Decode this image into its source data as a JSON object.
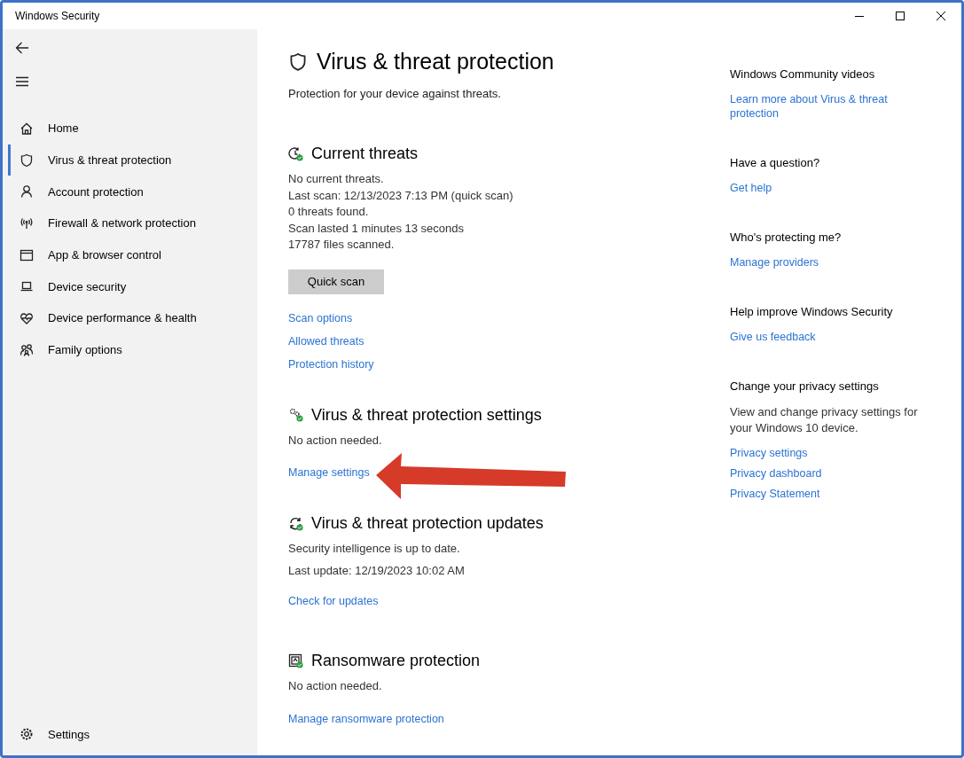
{
  "window": {
    "title": "Windows Security"
  },
  "sidebar": {
    "items": [
      {
        "label": "Home",
        "selected": false
      },
      {
        "label": "Virus & threat protection",
        "selected": true
      },
      {
        "label": "Account protection",
        "selected": false
      },
      {
        "label": "Firewall & network protection",
        "selected": false
      },
      {
        "label": "App & browser control",
        "selected": false
      },
      {
        "label": "Device security",
        "selected": false
      },
      {
        "label": "Device performance & health",
        "selected": false
      },
      {
        "label": "Family options",
        "selected": false
      }
    ],
    "settings": "Settings"
  },
  "page": {
    "title": "Virus & threat protection",
    "subtitle": "Protection for your device against threats."
  },
  "sections": [
    {
      "title": "Current threats",
      "lines": [
        "No current threats.",
        "Last scan: 12/13/2023 7:13 PM (quick scan)",
        "0 threats found.",
        "Scan lasted 1 minutes 13 seconds",
        "17787 files scanned."
      ],
      "button": "Quick scan",
      "links": [
        "Scan options",
        "Allowed threats",
        "Protection history"
      ]
    },
    {
      "title": "Virus & threat protection settings",
      "lines": [
        "No action needed."
      ],
      "links": [
        "Manage settings"
      ]
    },
    {
      "title": "Virus & threat protection updates",
      "lines": [
        "Security intelligence is up to date.",
        "Last update: 12/19/2023 10:02 AM"
      ],
      "links": [
        "Check for updates"
      ]
    },
    {
      "title": "Ransomware protection",
      "lines": [
        "No action needed."
      ],
      "links": [
        "Manage ransomware protection"
      ]
    }
  ],
  "aside": [
    {
      "heading": "Windows Community videos",
      "links": [
        "Learn more about Virus & threat protection"
      ]
    },
    {
      "heading": "Have a question?",
      "links": [
        "Get help"
      ]
    },
    {
      "heading": "Who's protecting me?",
      "links": [
        "Manage providers"
      ]
    },
    {
      "heading": "Help improve Windows Security",
      "links": [
        "Give us feedback"
      ]
    },
    {
      "heading": "Change your privacy settings",
      "text": "View and change privacy settings for your Windows 10 device.",
      "links": [
        "Privacy settings",
        "Privacy dashboard",
        "Privacy Statement"
      ]
    }
  ]
}
